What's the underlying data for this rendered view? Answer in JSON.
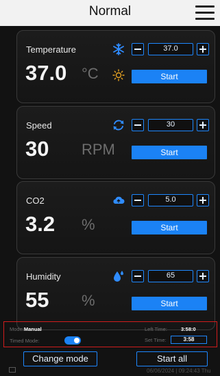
{
  "header": {
    "title": "Normal",
    "menu_icon": "hamburger-menu-icon"
  },
  "colors": {
    "accent": "#1b82f5",
    "background": "#121212",
    "alert_border": "#d11c1c"
  },
  "cards": [
    {
      "label": "Temperature",
      "value": "37.0",
      "unit": "°C",
      "icon": "snowflake-icon",
      "sub_icon": "sun-icon",
      "setpoint": "37.0",
      "start_label": "Start"
    },
    {
      "label": "Speed",
      "value": "30",
      "unit": "RPM",
      "icon": "rotate-icon",
      "setpoint": "30",
      "start_label": "Start"
    },
    {
      "label": "CO2",
      "value": "3.2",
      "unit": "%",
      "icon": "cloud-upload-icon",
      "setpoint": "5.0",
      "start_label": "Start"
    },
    {
      "label": "Humidity",
      "value": "55",
      "unit": "%",
      "icon": "water-drops-icon",
      "setpoint": "65",
      "start_label": "Start"
    }
  ],
  "status": {
    "mode_label": "Mode:",
    "mode_value": "Manual",
    "timed_mode_label": "Timed Mode:",
    "timed_mode_on": true,
    "left_time_label": "Left Time:",
    "left_time_value": "3:58:0",
    "set_time_label": "Set Time:",
    "set_time_value": "3:58"
  },
  "actions": {
    "change_mode_label": "Change mode",
    "start_all_label": "Start all"
  },
  "footer": {
    "datetime": "06/06/2024 | 09:24:43 Thu"
  }
}
